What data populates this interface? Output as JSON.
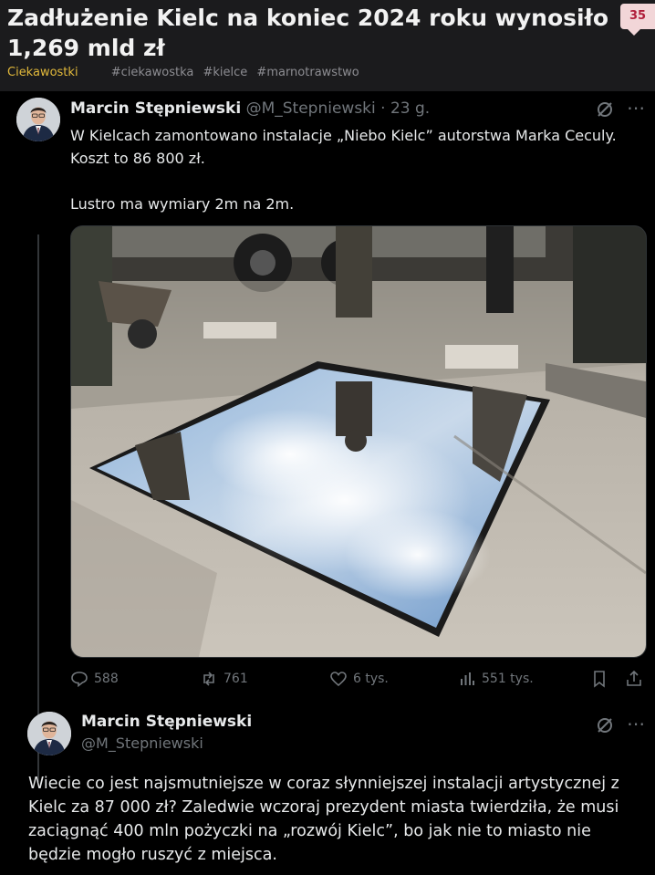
{
  "post": {
    "title": "Zadłużenie Kielc na koniec 2024 roku wynosiło 1,269 mld zł",
    "vote_count": "35",
    "category": "Ciekawostki",
    "tags": [
      "#ciekawostka",
      "#kielce",
      "#marnotrawstwo"
    ]
  },
  "tweet": {
    "author_name": "Marcin Stępniewski",
    "author_handle": "@M_Stepniewski",
    "time": "· 23 g.",
    "text_line1": "W Kielcach zamontowano instalacje „Niebo Kielc” autorstwa Marka Ceculy. Koszt to 86 800 zł.",
    "text_line2": "Lustro ma wymiary 2m na 2m.",
    "stats": {
      "replies": "588",
      "retweets": "761",
      "likes": "6 tys.",
      "views": "551 tys."
    }
  },
  "reply": {
    "author_name": "Marcin Stępniewski",
    "author_handle": "@M_Stepniewski",
    "text": "Wiecie co jest najsmutniejsze w coraz słynniejszej instalacji artystycznej z Kielc za 87 000 zł? Zaledwie wczoraj prezydent miasta twierdziła, że musi zaciągnąć 400 mln pożyczki na „rozwój Kielc”, bo jak nie to miasto nie będzie mogło ruszyć z miejsca."
  }
}
